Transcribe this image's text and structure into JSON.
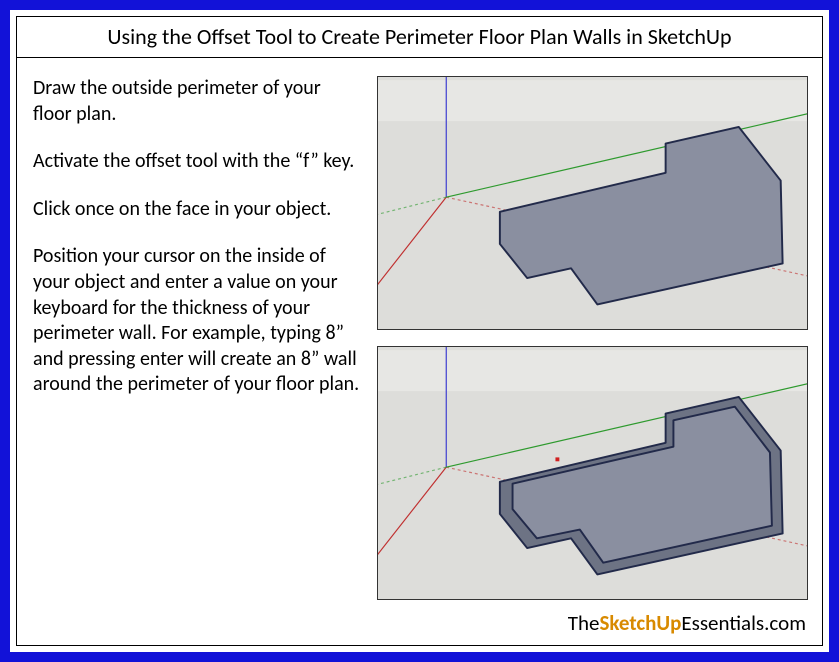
{
  "title": "Using the Offset Tool to Create Perimeter Floor Plan Walls in SketchUp",
  "instructions": {
    "p1": "Draw the outside perimeter of your floor plan.",
    "p2": "Activate the offset tool with the “f” key.",
    "p3": "Click once on the face in your object.",
    "p4": "Position your cursor on the inside of your object and enter a value on your keyboard for the thickness of your perimeter wall. For example, typing 8” and pressing enter will create an 8” wall around the perimeter of your floor plan."
  },
  "footer": {
    "prefix": "The",
    "accent": "SketchUp",
    "suffix": "Essentials.com"
  },
  "colors": {
    "frame_border": "#1212d8",
    "face_fill": "#8a8fa0",
    "edge": "#222a4a",
    "offset_face": "#797e90",
    "axis_red": "#c03030",
    "axis_green": "#2e9a2e",
    "axis_blue": "#3a3ad0",
    "ground": "#ddddda",
    "accent_text": "#d88a00"
  }
}
